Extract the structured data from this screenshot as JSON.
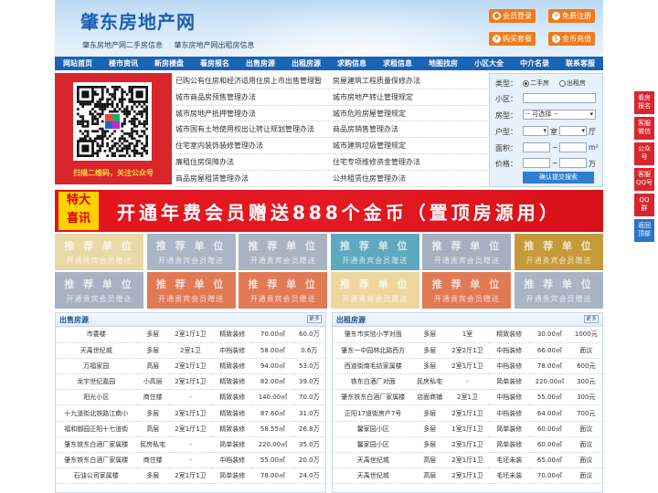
{
  "header": {
    "logo": "肇东房地产网",
    "subtitles": [
      "肇东房地产网二手房信息",
      "肇东房地产网出租房信息"
    ],
    "buttons": [
      {
        "label": "会员登录",
        "icon": "user-icon"
      },
      {
        "label": "免费注册",
        "icon": "plus-icon"
      },
      {
        "label": "购买套餐",
        "icon": "cart-icon"
      },
      {
        "label": "金币充值",
        "icon": "coin-icon"
      }
    ]
  },
  "nav": [
    "网站首页",
    "楼市资讯",
    "新房楼盘",
    "看房报名",
    "出售房源",
    "出租房源",
    "求购信息",
    "求租信息",
    "地图找房",
    "小区大全",
    "中介名录",
    "联系客服"
  ],
  "qr": {
    "caption": "扫描二维码，关注公众号"
  },
  "links": {
    "left": [
      "已购公有住房和经济适用住房上市出售管理暂",
      "城市商品房预售管理办法",
      "城市房地产抵押管理办法",
      "城市国有土地使用权出让转让规划管理办法",
      "住宅室内装饰装修管理办法",
      "廉租住房保障办法",
      "商品房屋租赁管理办法"
    ],
    "right": [
      "房屋建筑工程质量保修办法",
      "城市房地产转让管理规定",
      "城市危险房屋管理规定",
      "商品房销售管理办法",
      "城市建筑垃圾管理规定",
      "住宅专项维修资金管理办法",
      "公共租赁住房管理办法"
    ]
  },
  "search": {
    "type_label": "类型：",
    "opt1": "二手房",
    "opt2": "出租房",
    "area_label": "小区：",
    "layout_label": "房型：",
    "layout_select": "-- 可选择 --",
    "huxing_label": "户型：",
    "shi": "室",
    "ting": "厅",
    "size_label": "面积：",
    "sqm": "m²",
    "price_label": "价格：",
    "wan": "万",
    "tilde": "~",
    "submit": "确认提交搜索"
  },
  "banner": {
    "tag1": "特大",
    "tag2": "喜讯",
    "text": "开通年费会员赠送888个金币（置顶房源用）"
  },
  "tiles": {
    "title": "推 荐 单 位",
    "sub": "开通贵宾会员赠送",
    "colors": [
      "#ead9a8",
      "#aab5c6",
      "#a9b4c3",
      "#5fa9be",
      "#a6afbf",
      "#c59a3a",
      "#a7b2c2",
      "#e07a55",
      "#e27a55",
      "#edd79f",
      "#e07a55",
      "#a9b4c4"
    ]
  },
  "sale": {
    "title": "出售房源",
    "more": "更多",
    "rows": [
      [
        "市委楼",
        "多层",
        "2室1厅1卫",
        "精致装修",
        "70.00㎡",
        "60.0万"
      ],
      [
        "天禹世纪城",
        "多层",
        "2室1卫",
        "中档装修",
        "58.00㎡",
        "0.6万"
      ],
      [
        "万福家园",
        "高层",
        "2室1厅1卫",
        "精致装修",
        "94.00㎡",
        "53.0万"
      ],
      [
        "龙宇世纪嘉园",
        "小高层",
        "2室1厅1卫",
        "精致装修",
        "82.00㎡",
        "39.0万"
      ],
      [
        "阳光小区",
        "商住楼",
        "-",
        "精致装修",
        "140.00㎡",
        "70.0万"
      ],
      [
        "十九道街北铁路江南小",
        "多层",
        "2室1厅1卫",
        "精致装修",
        "87.60㎡",
        "31.0万"
      ],
      [
        "福和御园正阳十七道街",
        "高层",
        "2室1厅1卫",
        "精致装修",
        "58.55㎡",
        "26.8万"
      ],
      [
        "肇东铁东白酒厂家属楼",
        "民房私宅",
        "-",
        "简单装修",
        "220.00㎡",
        "35.0万"
      ],
      [
        "肇东铁东白酒厂家属楼",
        "商住楼",
        "-",
        "中档装修",
        "55.00㎡",
        "20.0万"
      ],
      [
        "石油公司家属楼",
        "多层",
        "2室1厅1卫",
        "简单装修",
        "78.00㎡",
        "24.0万"
      ]
    ]
  },
  "rent": {
    "title": "出租房源",
    "more": "更多",
    "rows": [
      [
        "肇东市实验小学对面",
        "多层",
        "1室",
        "精致装修",
        "30.00㎡",
        "1000元"
      ],
      [
        "肇东一中园林北路西方",
        "多层",
        "2室2厅1卫",
        "中档装修",
        "66.00㎡",
        "面议"
      ],
      [
        "西道街南毛纺家属楼",
        "多层",
        "2室1厅1卫",
        "中档装修",
        "78.00㎡",
        "600元"
      ],
      [
        "铁东白酒厂对面",
        "民房私宅",
        "-",
        "简单装修",
        "220.00㎡",
        "300元"
      ],
      [
        "肇东铁东白酒厂家属楼",
        "店面商铺",
        "2室1卫",
        "中档装修",
        "55.00㎡",
        "300元"
      ],
      [
        "正阳17道街房产7号",
        "多层",
        "2室1厅1卫",
        "中档装修",
        "64.00㎡",
        "700元"
      ],
      [
        "馨家园小区",
        "多层",
        "1室1厅1卫",
        "简单装修",
        "60.00㎡",
        "面议"
      ],
      [
        "馨家园小区",
        "多层",
        "2室1厅1卫",
        "简单装修",
        "60.00㎡",
        "面议"
      ],
      [
        "天禹世纪城",
        "高层",
        "2室1厅1卫",
        "毛坯未装",
        "65.00㎡",
        "面议"
      ],
      [
        "天禹世纪城",
        "高层",
        "2室1厅1卫",
        "毛坯未装",
        "70.00㎡",
        "面议"
      ]
    ]
  },
  "float": [
    [
      "看房",
      "报名"
    ],
    [
      "客服",
      "微信"
    ],
    [
      "公众",
      "号"
    ],
    [
      "客服",
      "QQ号"
    ],
    [
      "QQ",
      "群"
    ],
    [
      "返回",
      "顶部"
    ]
  ]
}
